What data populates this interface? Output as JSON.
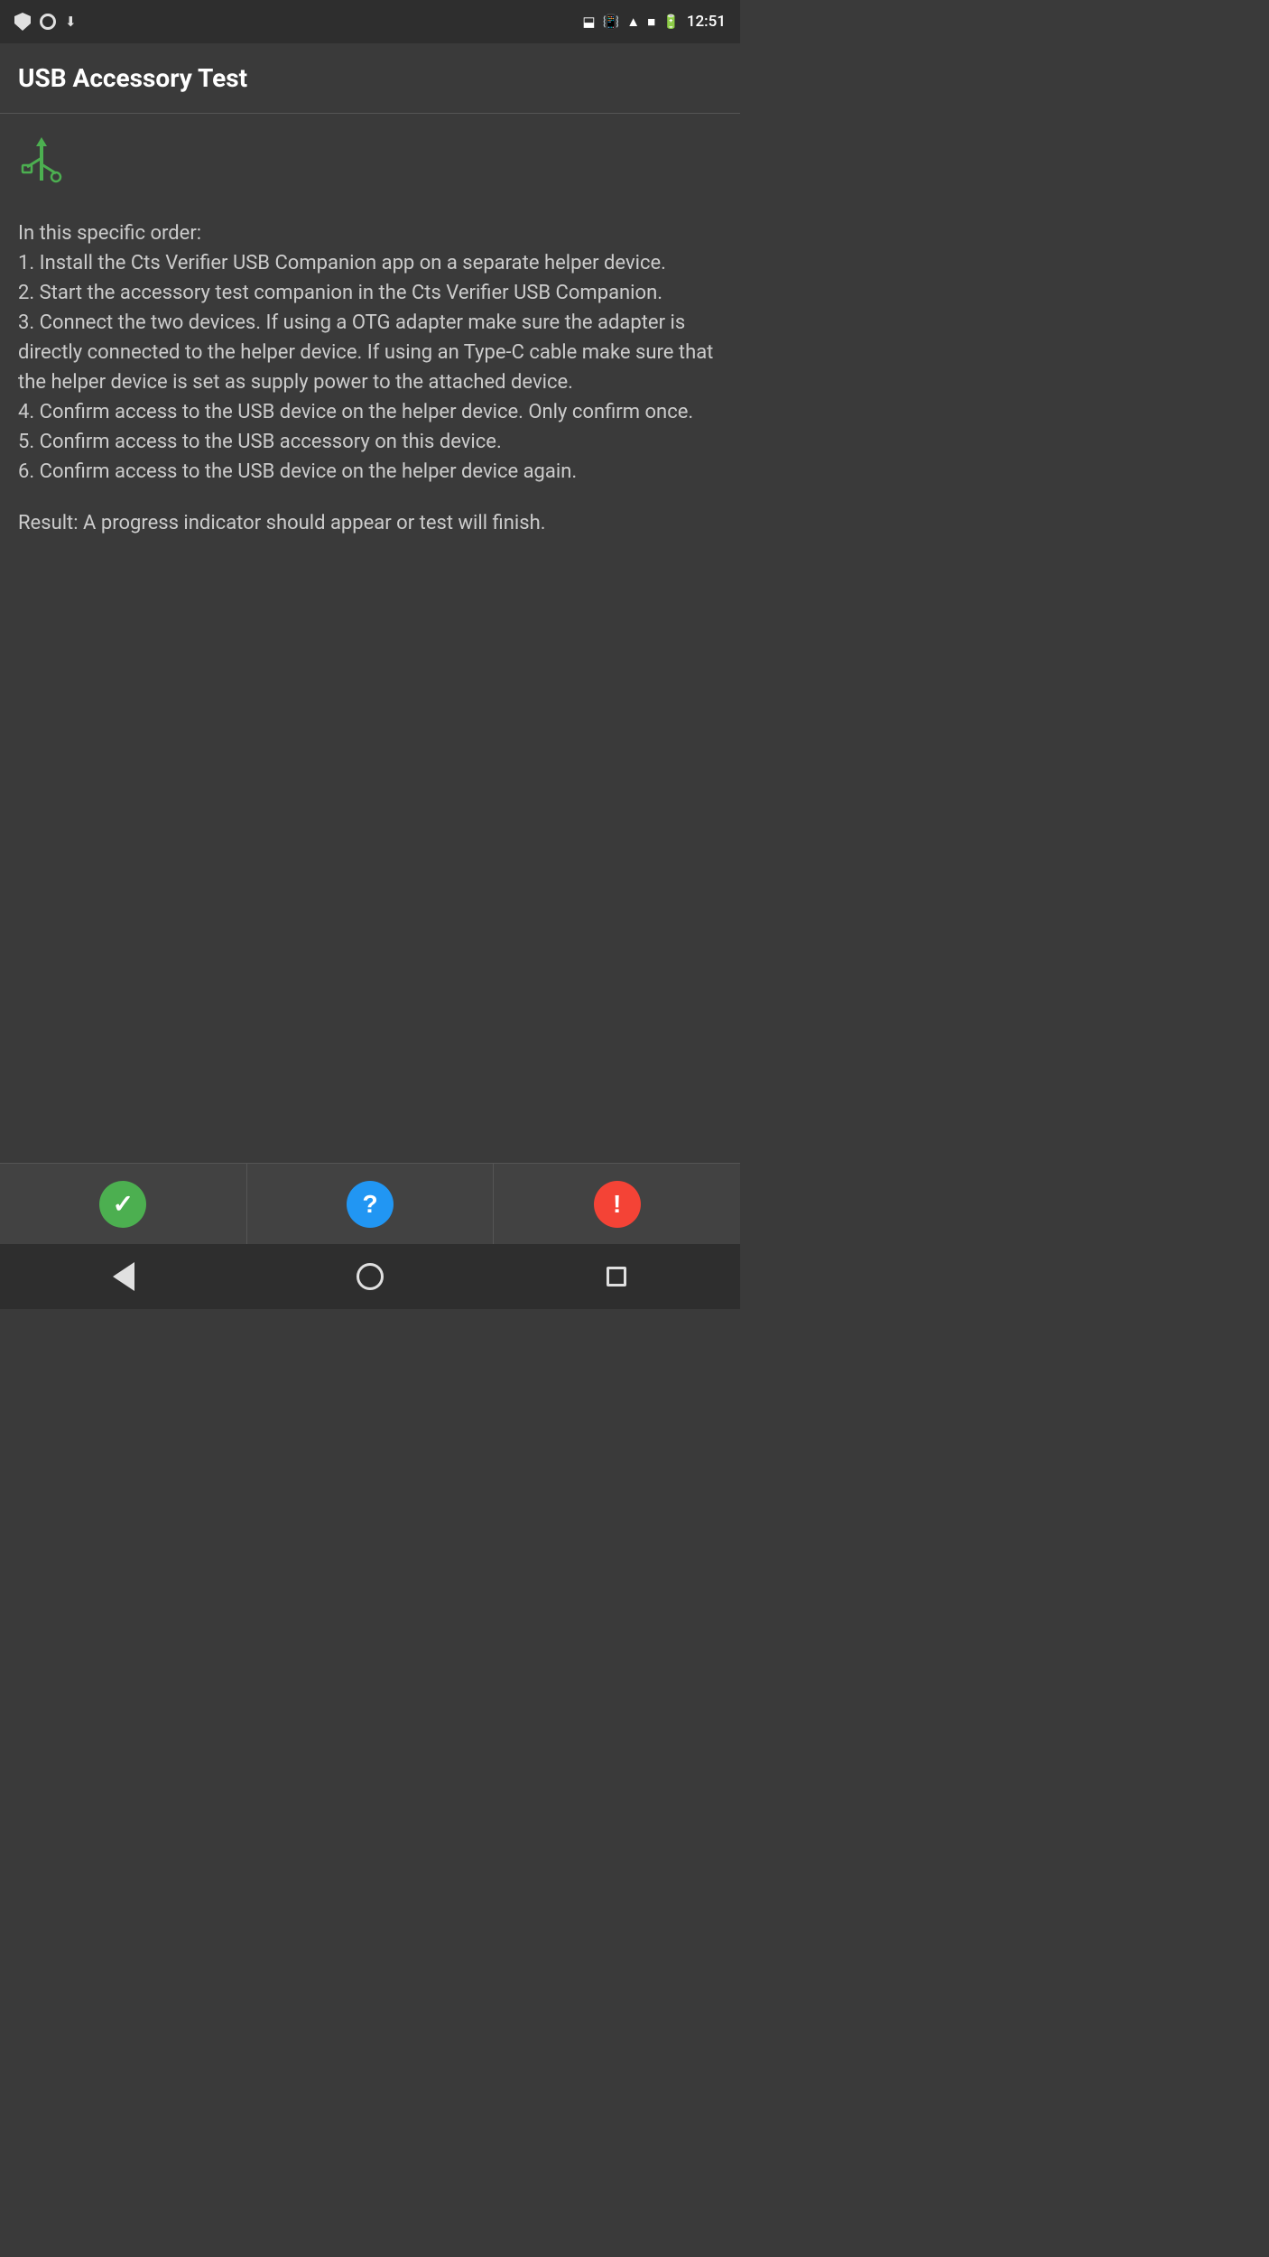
{
  "statusBar": {
    "time": "12:51",
    "icons": {
      "bluetooth": "bluetooth-icon",
      "vibrate": "vibrate-icon",
      "wifi": "wifi-icon",
      "signal": "signal-icon",
      "battery": "battery-icon"
    }
  },
  "header": {
    "title": "USB Accessory Test"
  },
  "content": {
    "usbIcon": "⊕",
    "instructions": "In this specific order:\n1. Install the Cts Verifier USB Companion app on a separate helper device.\n2. Start the accessory test companion in the Cts Verifier USB Companion.\n3. Connect the two devices. If using a OTG adapter make sure the adapter is directly connected to the helper device. If using an Type-C cable make sure that the helper device is set as supply power to the attached device.\n4. Confirm access to the USB device on the helper device. Only confirm once.\n5. Confirm access to the USB accessory on this device.\n6. Confirm access to the USB device on the helper device again.",
    "result": "Result: A progress indicator should appear or test will finish."
  },
  "bottomBar": {
    "passLabel": "✓",
    "infoLabel": "?",
    "failLabel": "!"
  },
  "navBar": {
    "backLabel": "",
    "homeLabel": "",
    "recentLabel": ""
  }
}
